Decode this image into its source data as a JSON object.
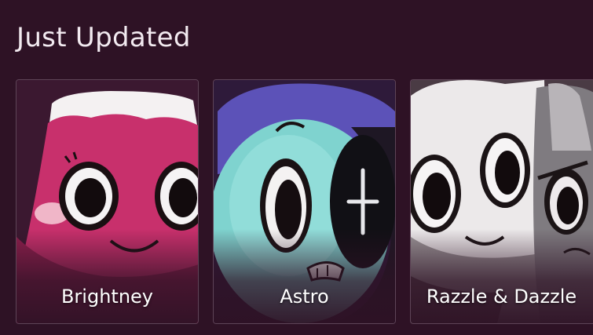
{
  "section": {
    "title": "Just Updated"
  },
  "cards": [
    {
      "name": "Brightney",
      "icon": "brightney-character-art"
    },
    {
      "name": "Astro",
      "icon": "astro-character-art"
    },
    {
      "name": "Razzle & Dazzle",
      "icon": "razzle-dazzle-character-art"
    }
  ],
  "colors": {
    "background": "#2e1225",
    "card_border": "#5e4457",
    "title_text": "#f2eaf0",
    "card_text": "#ffffff"
  }
}
